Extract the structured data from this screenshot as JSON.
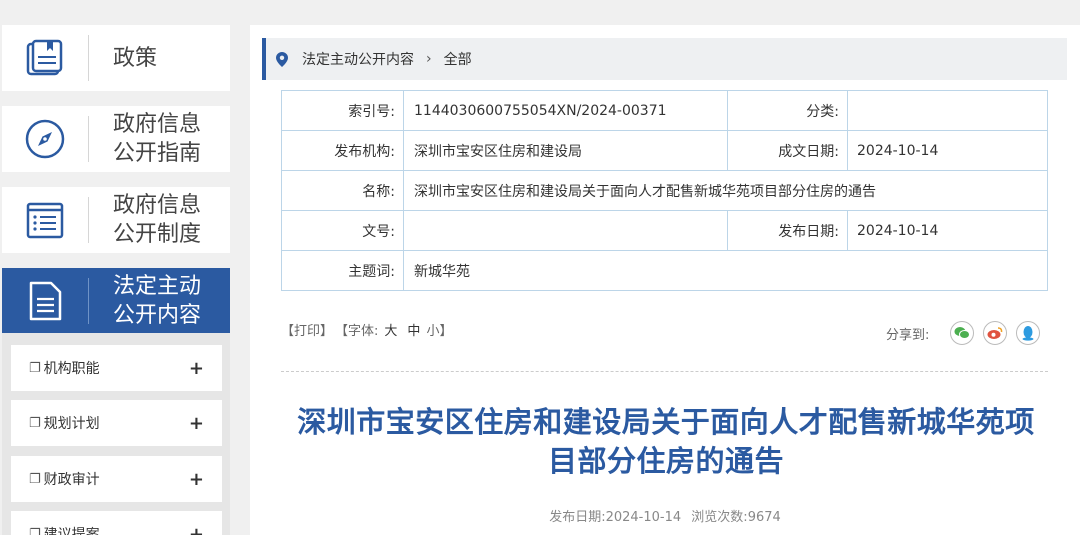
{
  "sidebar": {
    "nav": [
      {
        "label_line1": "政策",
        "label_line2": "",
        "icon": "book-icon"
      },
      {
        "label_line1": "政府信息",
        "label_line2": "公开指南",
        "icon": "compass-icon"
      },
      {
        "label_line1": "政府信息",
        "label_line2": "公开制度",
        "icon": "list-document-icon"
      },
      {
        "label_line1": "法定主动",
        "label_line2": "公开内容",
        "icon": "document-icon"
      }
    ],
    "sub_items": [
      {
        "label": "机构职能",
        "expand": "+"
      },
      {
        "label": "规划计划",
        "expand": "+"
      },
      {
        "label": "财政审计",
        "expand": "+"
      },
      {
        "label": "建议提案",
        "expand": "+"
      }
    ]
  },
  "breadcrumb": {
    "part1": "法定主动公开内容",
    "separator": "›",
    "part2": "全部"
  },
  "meta": {
    "index_label": "索引号:",
    "index_value": "1144030600755054XN/2024-00371",
    "category_label": "分类:",
    "category_value": "",
    "issuer_label": "发布机构:",
    "issuer_value": "深圳市宝安区住房和建设局",
    "created_label": "成文日期:",
    "created_value": "2024-10-14",
    "name_label": "名称:",
    "name_value": "深圳市宝安区住房和建设局关于面向人才配售新城华苑项目部分住房的通告",
    "docno_label": "文号:",
    "docno_value": "",
    "published_label": "发布日期:",
    "published_value": "2024-10-14",
    "keywords_label": "主题词:",
    "keywords_value": "新城华苑"
  },
  "tools": {
    "print": "【打印】",
    "font_prefix": "【字体:",
    "large": "大",
    "medium": "中",
    "small": "小】"
  },
  "share": {
    "label": "分享到:",
    "wechat_color": "#4caf50",
    "weibo_color": "#e0523f",
    "qq_color": "#2d9be0"
  },
  "article": {
    "title_line1": "深圳市宝安区住房和建设局关于面向人才配售新城华苑项",
    "title_line2": "目部分住房的通告",
    "date_label": "发布日期:",
    "date_value": "2024-10-14",
    "views_label": "浏览次数:",
    "views_value": "9674"
  },
  "colors": {
    "accent": "#2b5aa1",
    "table_border": "#bcd5e8"
  }
}
